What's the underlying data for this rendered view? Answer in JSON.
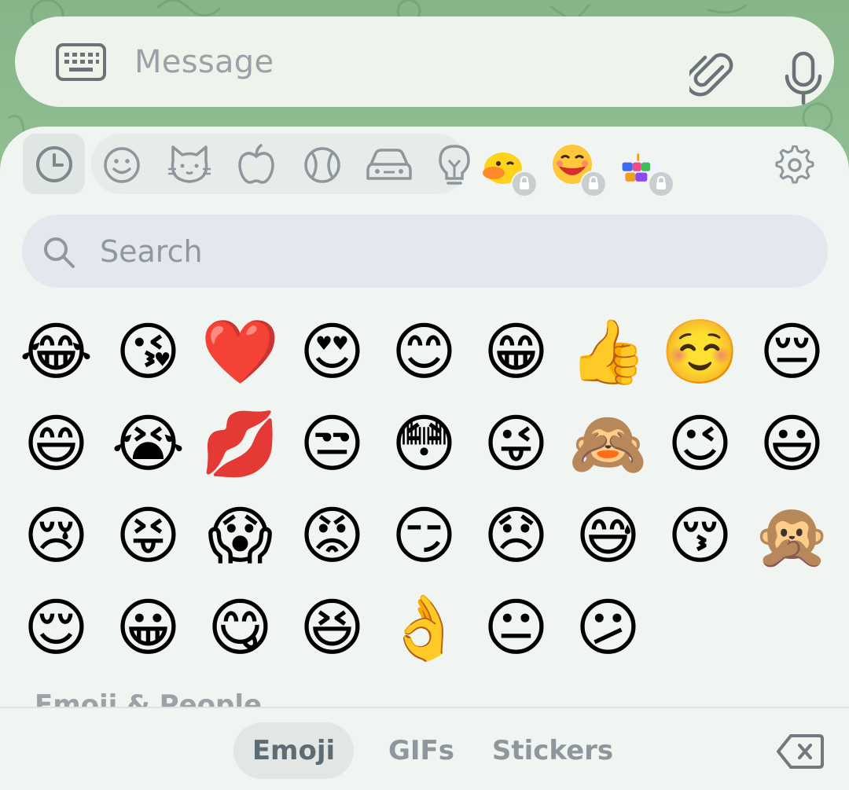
{
  "composer": {
    "placeholder": "Message",
    "keyboard_icon": "keyboard-icon",
    "attach_icon": "paperclip-icon",
    "mic_icon": "microphone-icon"
  },
  "emoji_panel": {
    "categories": [
      {
        "icon": "clock-icon",
        "name": "recent",
        "active": true
      },
      {
        "icon": "smiley-icon",
        "name": "smileys"
      },
      {
        "icon": "cat-icon",
        "name": "animals"
      },
      {
        "icon": "apple-icon",
        "name": "food"
      },
      {
        "icon": "ball-icon",
        "name": "activity"
      },
      {
        "icon": "car-icon",
        "name": "travel"
      },
      {
        "icon": "bulb-icon",
        "name": "objects"
      }
    ],
    "packs": [
      {
        "icon": "duck-sticker-icon",
        "locked": true
      },
      {
        "icon": "face-sticker-icon",
        "locked": true
      },
      {
        "icon": "birthday-sticker-icon",
        "locked": true
      }
    ],
    "settings_icon": "gear-icon",
    "search_placeholder": "Search",
    "recent_emojis": [
      "😂",
      "😘",
      "❤️",
      "😍",
      "😊",
      "😁",
      "👍",
      "☺️",
      "😔",
      "😄",
      "😭",
      "💋",
      "😒",
      "😳",
      "😜",
      "🙈",
      "😉",
      "😃",
      "😢",
      "😝",
      "😱",
      "😡",
      "😏",
      "😞",
      "😅",
      "😚",
      "🙊",
      "😌",
      "😀",
      "😋",
      "😆",
      "👌",
      "😐",
      "😕"
    ],
    "section_label": "Emoji & People"
  },
  "bottom_tabs": {
    "tabs": [
      {
        "label": "Emoji",
        "active": true
      },
      {
        "label": "GIFs",
        "active": false
      },
      {
        "label": "Stickers",
        "active": false
      }
    ],
    "backspace_icon": "backspace-icon"
  }
}
